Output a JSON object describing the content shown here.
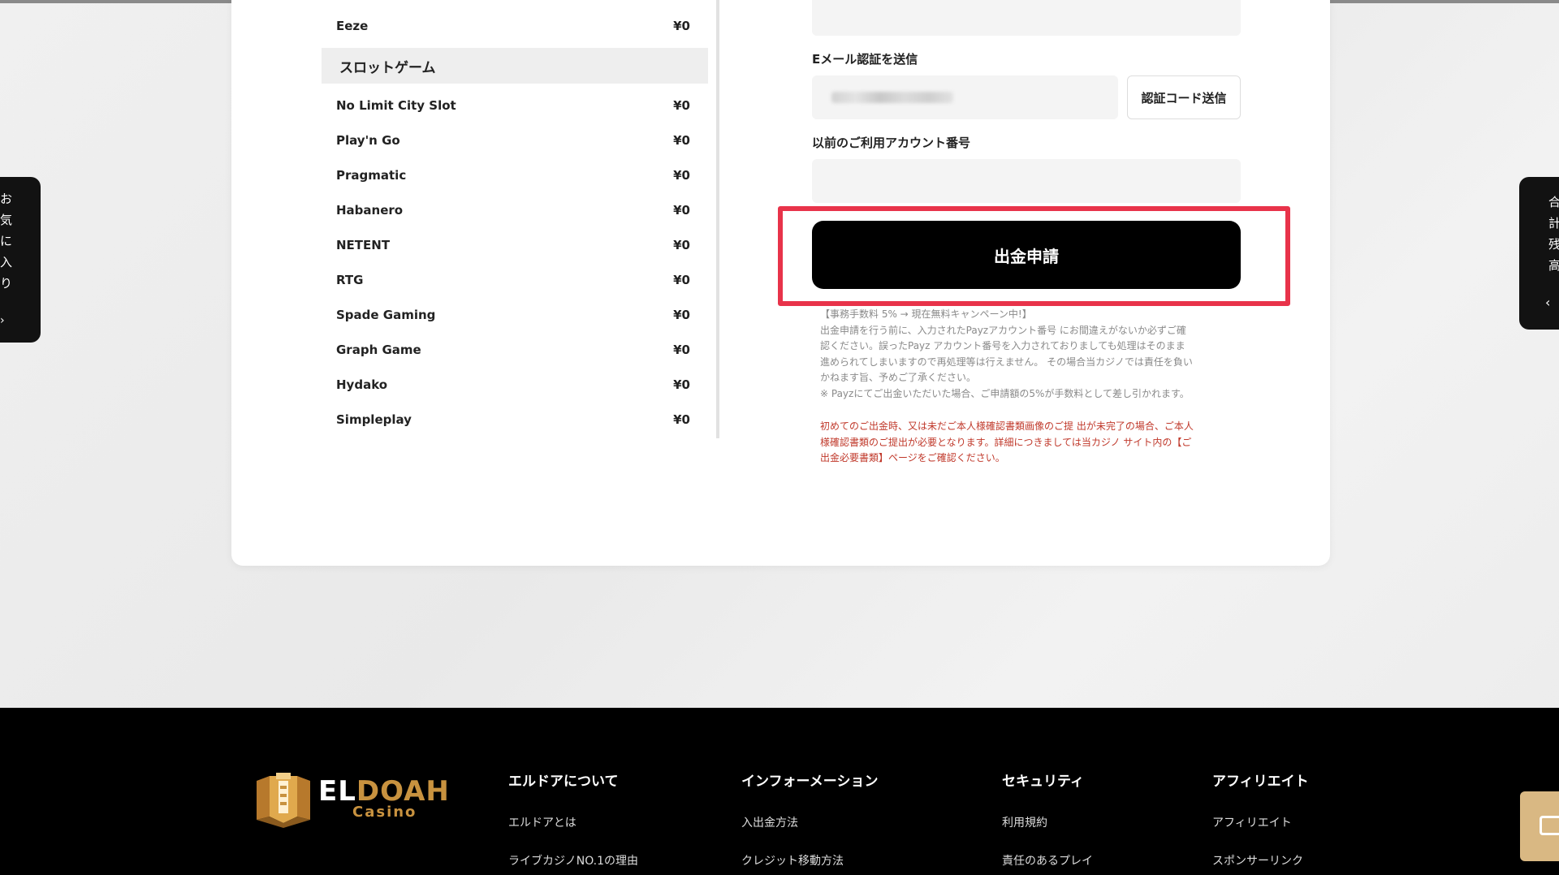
{
  "balances": {
    "top_row": {
      "name": "Eeze",
      "value": "¥0"
    },
    "section_title": "スロットゲーム",
    "slots": [
      {
        "name": "No Limit City Slot",
        "value": "¥0"
      },
      {
        "name": "Play'n Go",
        "value": "¥0"
      },
      {
        "name": "Pragmatic",
        "value": "¥0"
      },
      {
        "name": "Habanero",
        "value": "¥0"
      },
      {
        "name": "NETENT",
        "value": "¥0"
      },
      {
        "name": "RTG",
        "value": "¥0"
      },
      {
        "name": "Spade Gaming",
        "value": "¥0"
      },
      {
        "name": "Graph Game",
        "value": "¥0"
      },
      {
        "name": "Hydako",
        "value": "¥0"
      },
      {
        "name": "Simpleplay",
        "value": "¥0"
      }
    ]
  },
  "form": {
    "email_label": "Eメール認証を送信",
    "send_code_button": "認証コード送信",
    "account_label": "以前のご利用アカウント番号",
    "submit_button": "出金申請",
    "notes": [
      "【事務手数料 5% → 現在無料キャンペーン中!】",
      "出金申請を行う前に、入力されたPayzアカウント番号 にお間違えがないか必ずご確",
      "認ください。誤ったPayz アカウント番号を入力されておりましても処理はそのまま",
      "進められてしまいますので再処理等は行えません。 その場合当カジノでは責任を負い",
      "かねます旨、予めご了承ください。",
      "※ Payzにてご出金いただいた場合、ご申請額の5%が手数料として差し引かれます。"
    ],
    "notes_red": [
      "初めてのご出金時、又は未だご本人様確認書類画像のご提 出が未完了の場合、ご本人",
      "様確認書類のご提出が必要となります。詳細につきましては当カジノ サイト内の【ご",
      "出金必要書類】ページをご確認ください。"
    ]
  },
  "side_tabs": {
    "favorites": [
      "お",
      "気",
      "に",
      "入",
      "り"
    ],
    "favorites_arrow": "›",
    "total": [
      "合",
      "計",
      "残",
      "高"
    ],
    "total_arrow": "‹"
  },
  "footer": {
    "logo_text": "ELDOAH",
    "logo_sub": "Casino",
    "columns": [
      {
        "title": "エルドアについて",
        "links": [
          "エルドアとは",
          "ライブカジノNO.1の理由"
        ]
      },
      {
        "title": "インフォーメーション",
        "links": [
          "入出金方法",
          "クレジット移動方法"
        ]
      },
      {
        "title": "セキュリティ",
        "links": [
          "利用規約",
          "責任のあるプレイ"
        ]
      },
      {
        "title": "アフィリエイト",
        "links": [
          "アフィリエイト",
          "スポンサーリンク"
        ]
      }
    ]
  },
  "colors": {
    "highlight": "#e8334a",
    "brand_gold": "#c8923f",
    "chat_button": "#d9b883"
  }
}
